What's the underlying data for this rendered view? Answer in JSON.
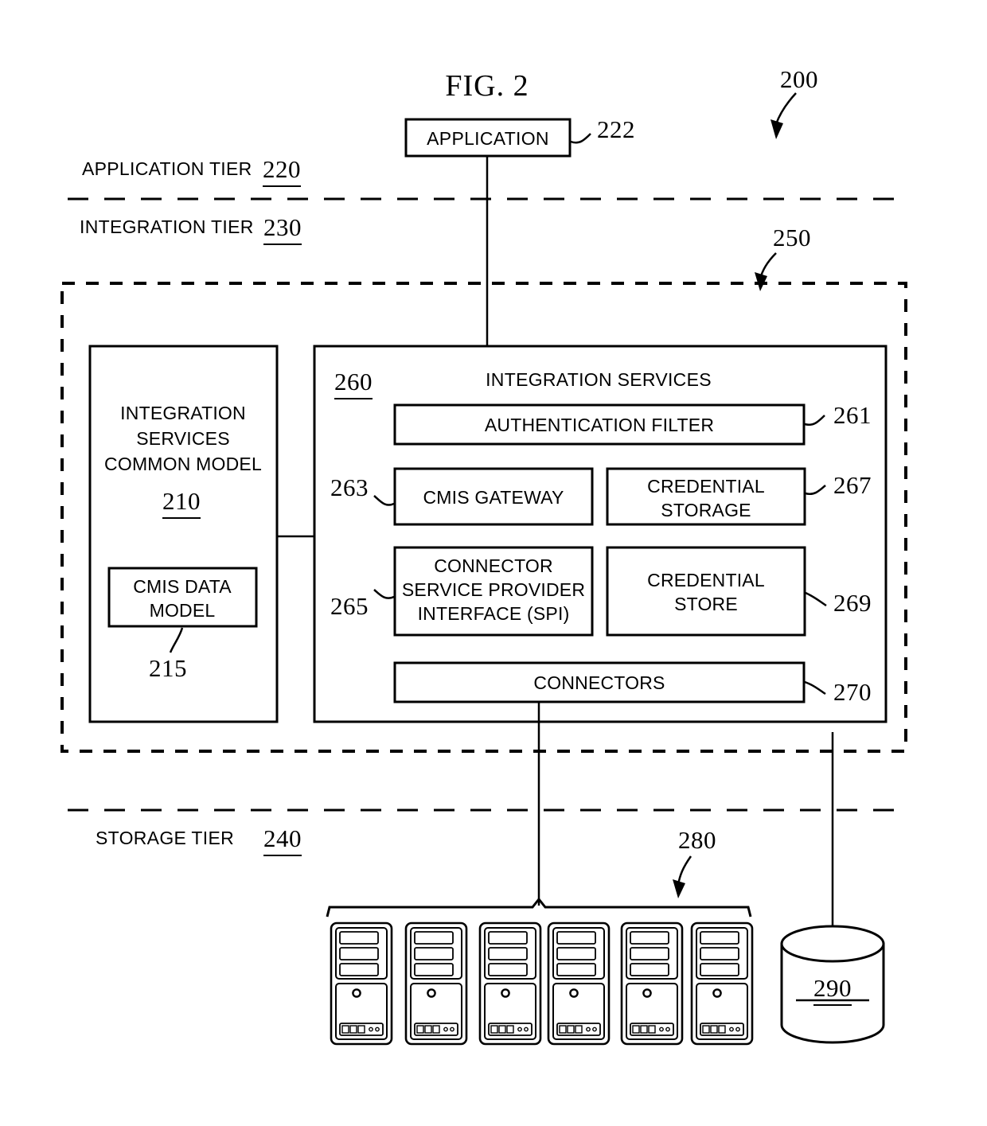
{
  "figure": {
    "title": "FIG. 2",
    "system_ref": "200",
    "tiers": [
      {
        "name": "APPLICATION TIER",
        "ref": "220"
      },
      {
        "name": "INTEGRATION TIER",
        "ref": "230"
      },
      {
        "name": "STORAGE TIER",
        "ref": "240"
      }
    ]
  },
  "application": {
    "label": "APPLICATION",
    "ref": "222"
  },
  "integration_platform": {
    "ref": "250"
  },
  "common_model": {
    "title_line1": "INTEGRATION",
    "title_line2": "SERVICES",
    "title_line3": "COMMON MODEL",
    "ref": "210",
    "data_model": {
      "line1": "CMIS DATA",
      "line2": "MODEL",
      "ref": "215"
    }
  },
  "integration_services": {
    "title": "INTEGRATION SERVICES",
    "ref": "260",
    "components": [
      {
        "label": "AUTHENTICATION FILTER",
        "ref": "261"
      },
      {
        "label": "CMIS GATEWAY",
        "ref": "263"
      },
      {
        "label_line1": "CREDENTIAL",
        "label_line2": "STORAGE",
        "ref": "267"
      },
      {
        "label_line1": "CONNECTOR",
        "label_line2": "SERVICE PROVIDER",
        "label_line3": "INTERFACE (SPI)",
        "ref": "265"
      },
      {
        "label_line1": "CREDENTIAL",
        "label_line2": "STORE",
        "ref": "269"
      },
      {
        "label": "CONNECTORS",
        "ref": "270"
      }
    ]
  },
  "storage": {
    "server_group_ref": "280",
    "server_count": 6,
    "database_ref": "290"
  },
  "colors": {
    "stroke": "#000000",
    "background": "#ffffff"
  }
}
